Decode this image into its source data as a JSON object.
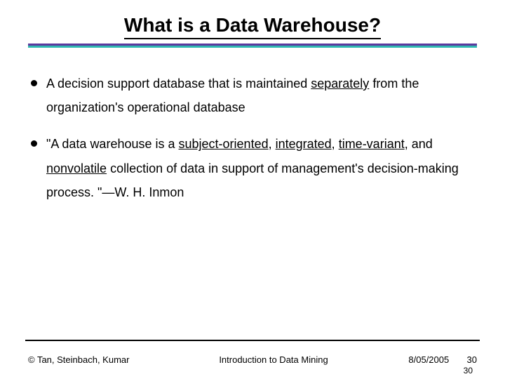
{
  "title": "What is a Data Warehouse?",
  "bullets": [
    {
      "segments": [
        {
          "text": "A decision support database that is maintained "
        },
        {
          "text": "separately",
          "underline": true
        },
        {
          "text": " from the organization's operational database"
        }
      ]
    },
    {
      "segments": [
        {
          "text": "\"A data warehouse is a "
        },
        {
          "text": "subject-oriented",
          "underline": true
        },
        {
          "text": ", "
        },
        {
          "text": "integrated",
          "underline": true
        },
        {
          "text": ", "
        },
        {
          "text": "time-variant",
          "underline": true
        },
        {
          "text": ", and "
        },
        {
          "text": "nonvolatile",
          "underline": true
        },
        {
          "text": " collection of data in support of management's decision-making process. \"—W. H. Inmon"
        }
      ]
    }
  ],
  "footer": {
    "left": "© Tan, Steinbach, Kumar",
    "center": "Introduction to Data Mining",
    "date": "8/05/2005",
    "page": "30",
    "page_dup": "30"
  }
}
